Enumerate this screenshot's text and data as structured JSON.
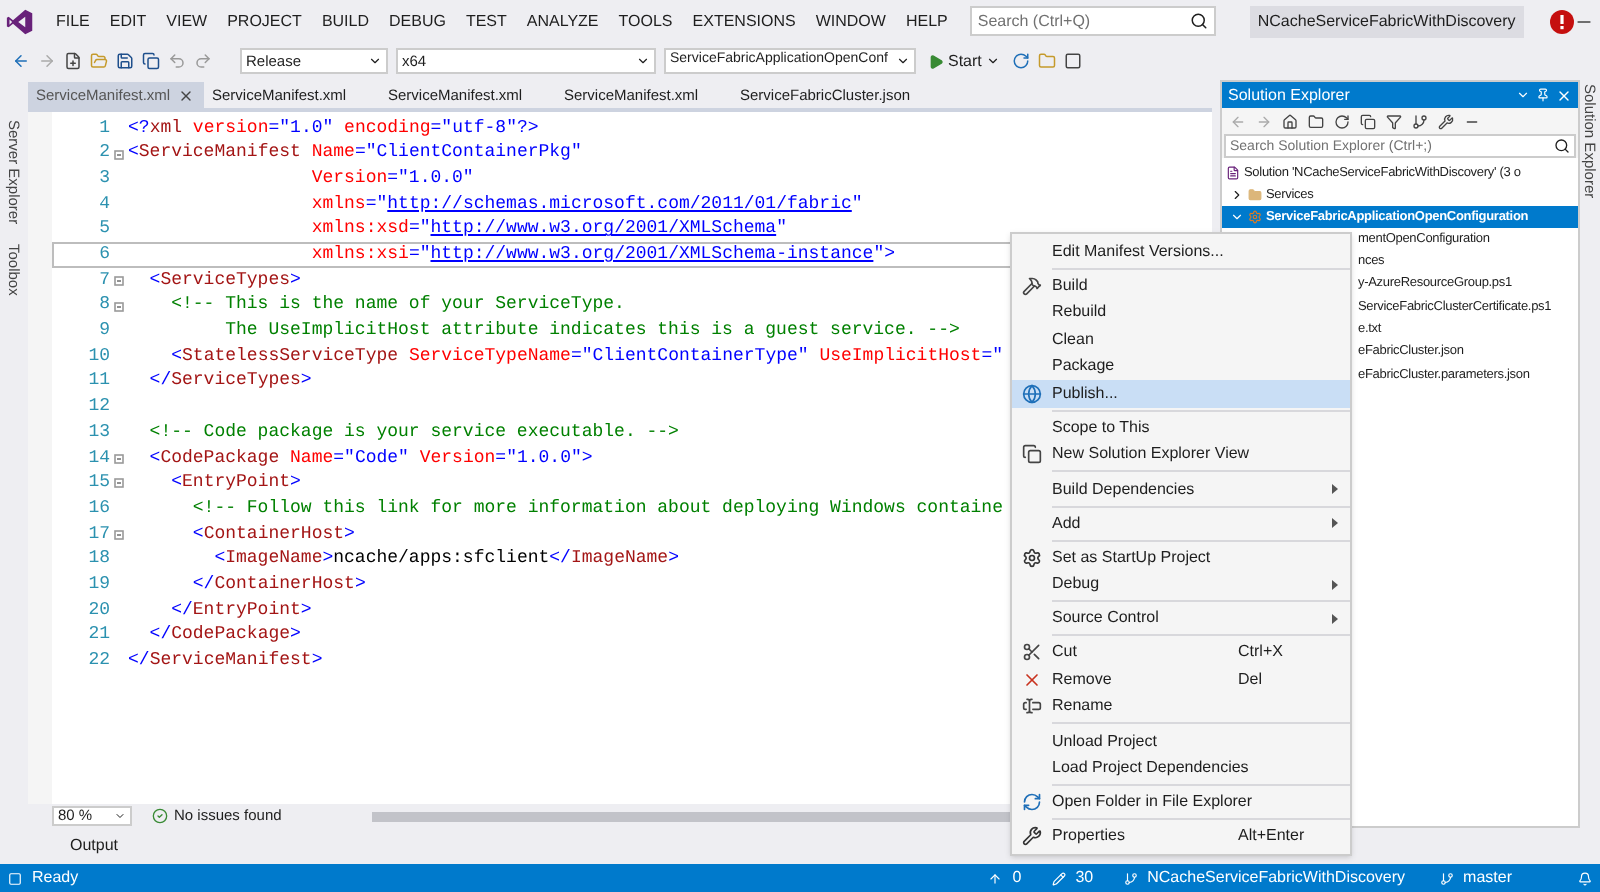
{
  "menu_bar": {
    "items": [
      "FILE",
      "EDIT",
      "VIEW",
      "PROJECT",
      "BUILD",
      "DEBUG",
      "TEST",
      "ANALYZE",
      "TOOLS",
      "EXTENSIONS",
      "WINDOW",
      "HELP"
    ],
    "search": {
      "placeholder": "Search (Ctrl+Q)"
    },
    "solution_name": "NCacheServiceFabricWithDiscovery"
  },
  "toolbar": {
    "configuration": "Release",
    "platform": "x64",
    "startup_project": "ServiceFabricApplicationOpenConf",
    "start": "Start"
  },
  "left_strip": [
    "Server Explorer",
    "Toolbox"
  ],
  "tabs": [
    {
      "label": "ServiceManifest.xml",
      "selected": true,
      "closable": true
    },
    {
      "label": "ServiceManifest.xml",
      "selected": false,
      "closable": false
    },
    {
      "label": "ServiceManifest.xml",
      "selected": false,
      "closable": false
    },
    {
      "label": "ServiceManifest.xml",
      "selected": false,
      "closable": false
    },
    {
      "label": "ServiceFabricCluster.json",
      "selected": false,
      "closable": false
    }
  ],
  "editor": {
    "lines": [
      {
        "number": "1",
        "fold": false,
        "current": false,
        "tokens": [
          {
            "kind": "punct",
            "text": "<?"
          },
          {
            "kind": "tag",
            "text": "xml"
          },
          {
            "kind": "attr",
            "text": " version"
          },
          {
            "kind": "punct",
            "text": "="
          },
          {
            "kind": "value",
            "text": "\"1.0\""
          },
          {
            "kind": "attr",
            "text": " encoding"
          },
          {
            "kind": "punct",
            "text": "="
          },
          {
            "kind": "value",
            "text": "\"utf-8\""
          },
          {
            "kind": "punct",
            "text": "?>"
          }
        ]
      },
      {
        "number": "2",
        "fold": true,
        "current": false,
        "tokens": [
          {
            "kind": "punct",
            "text": "<"
          },
          {
            "kind": "tag",
            "text": "ServiceManifest"
          },
          {
            "kind": "attr",
            "text": " Name"
          },
          {
            "kind": "punct",
            "text": "="
          },
          {
            "kind": "value",
            "text": "\"ClientContainerPkg\""
          }
        ]
      },
      {
        "number": "3",
        "fold": false,
        "current": false,
        "tokens": [
          {
            "kind": "attr",
            "text": "                 Version"
          },
          {
            "kind": "punct",
            "text": "="
          },
          {
            "kind": "value",
            "text": "\"1.0.0\""
          }
        ]
      },
      {
        "number": "4",
        "fold": false,
        "current": false,
        "tokens": [
          {
            "kind": "attr",
            "text": "                 xmlns"
          },
          {
            "kind": "punct",
            "text": "="
          },
          {
            "kind": "value",
            "text": "\""
          },
          {
            "kind": "link",
            "text": "http://schemas.microsoft.com/2011/01/fabric"
          },
          {
            "kind": "value",
            "text": "\""
          }
        ]
      },
      {
        "number": "5",
        "fold": false,
        "current": false,
        "tokens": [
          {
            "kind": "attr",
            "text": "                 xmlns:xsd"
          },
          {
            "kind": "punct",
            "text": "="
          },
          {
            "kind": "value",
            "text": "\""
          },
          {
            "kind": "link",
            "text": "http://www.w3.org/2001/XMLSchema"
          },
          {
            "kind": "value",
            "text": "\""
          }
        ]
      },
      {
        "number": "6",
        "fold": false,
        "current": true,
        "tokens": [
          {
            "kind": "attr",
            "text": "                 xmlns:xsi"
          },
          {
            "kind": "punct",
            "text": "="
          },
          {
            "kind": "value",
            "text": "\""
          },
          {
            "kind": "link",
            "text": "http://www.w3.org/2001/XMLSchema-instance"
          },
          {
            "kind": "value",
            "text": "\""
          },
          {
            "kind": "punct",
            "text": ">"
          }
        ]
      },
      {
        "number": "7",
        "fold": true,
        "current": false,
        "tokens": [
          {
            "kind": "punct",
            "text": "  <"
          },
          {
            "kind": "tag",
            "text": "ServiceTypes"
          },
          {
            "kind": "punct",
            "text": ">"
          }
        ]
      },
      {
        "number": "8",
        "fold": true,
        "current": false,
        "tokens": [
          {
            "kind": "comment",
            "text": "    <!-- This is the name of your ServiceType."
          }
        ]
      },
      {
        "number": "9",
        "fold": false,
        "current": false,
        "tokens": [
          {
            "kind": "comment",
            "text": "         The UseImplicitHost attribute indicates this is a guest service. -->"
          }
        ]
      },
      {
        "number": "10",
        "fold": false,
        "current": false,
        "tokens": [
          {
            "kind": "punct",
            "text": "    <"
          },
          {
            "kind": "tag",
            "text": "StatelessServiceType"
          },
          {
            "kind": "attr",
            "text": " ServiceTypeName"
          },
          {
            "kind": "punct",
            "text": "="
          },
          {
            "kind": "value",
            "text": "\"ClientContainerType\""
          },
          {
            "kind": "attr",
            "text": " UseImplicitHost"
          },
          {
            "kind": "punct",
            "text": "="
          },
          {
            "kind": "value",
            "text": "\""
          }
        ]
      },
      {
        "number": "11",
        "fold": false,
        "current": false,
        "tokens": [
          {
            "kind": "punct",
            "text": "  </"
          },
          {
            "kind": "tag",
            "text": "ServiceTypes"
          },
          {
            "kind": "punct",
            "text": ">"
          }
        ]
      },
      {
        "number": "12",
        "fold": false,
        "current": false
      },
      {
        "number": "13",
        "fold": false,
        "current": false,
        "tokens": [
          {
            "kind": "comment",
            "text": "  <!-- Code package is your service executable. -->"
          }
        ]
      },
      {
        "number": "14",
        "fold": true,
        "current": false,
        "tokens": [
          {
            "kind": "punct",
            "text": "  <"
          },
          {
            "kind": "tag",
            "text": "CodePackage"
          },
          {
            "kind": "attr",
            "text": " Name"
          },
          {
            "kind": "punct",
            "text": "="
          },
          {
            "kind": "value",
            "text": "\"Code\""
          },
          {
            "kind": "attr",
            "text": " Version"
          },
          {
            "kind": "punct",
            "text": "="
          },
          {
            "kind": "value",
            "text": "\"1.0.0\""
          },
          {
            "kind": "punct",
            "text": ">"
          }
        ]
      },
      {
        "number": "15",
        "fold": true,
        "current": false,
        "tokens": [
          {
            "kind": "punct",
            "text": "    <"
          },
          {
            "kind": "tag",
            "text": "EntryPoint"
          },
          {
            "kind": "punct",
            "text": ">"
          }
        ]
      },
      {
        "number": "16",
        "fold": false,
        "current": false,
        "tokens": [
          {
            "kind": "comment",
            "text": "      <!-- Follow this link for more information about deploying Windows containe"
          }
        ]
      },
      {
        "number": "17",
        "fold": true,
        "current": false,
        "tokens": [
          {
            "kind": "punct",
            "text": "      <"
          },
          {
            "kind": "tag",
            "text": "ContainerHost"
          },
          {
            "kind": "punct",
            "text": ">"
          }
        ]
      },
      {
        "number": "18",
        "fold": false,
        "current": false,
        "tokens": [
          {
            "kind": "punct",
            "text": "        <"
          },
          {
            "kind": "tag",
            "text": "ImageName"
          },
          {
            "kind": "punct",
            "text": ">"
          },
          {
            "kind": "text",
            "text": "ncache/apps:sfclient"
          },
          {
            "kind": "punct",
            "text": "</"
          },
          {
            "kind": "tag",
            "text": "ImageName"
          },
          {
            "kind": "punct",
            "text": ">"
          }
        ]
      },
      {
        "number": "19",
        "fold": false,
        "current": false,
        "tokens": [
          {
            "kind": "punct",
            "text": "      </"
          },
          {
            "kind": "tag",
            "text": "ContainerHost"
          },
          {
            "kind": "punct",
            "text": ">"
          }
        ]
      },
      {
        "number": "20",
        "fold": false,
        "current": false,
        "tokens": [
          {
            "kind": "punct",
            "text": "    </"
          },
          {
            "kind": "tag",
            "text": "EntryPoint"
          },
          {
            "kind": "punct",
            "text": ">"
          }
        ]
      },
      {
        "number": "21",
        "fold": false,
        "current": false,
        "tokens": [
          {
            "kind": "punct",
            "text": "  </"
          },
          {
            "kind": "tag",
            "text": "CodePackage"
          },
          {
            "kind": "punct",
            "text": ">"
          }
        ]
      },
      {
        "number": "22",
        "fold": false,
        "current": false,
        "tokens": [
          {
            "kind": "punct",
            "text": "</"
          },
          {
            "kind": "tag",
            "text": "ServiceManifest"
          },
          {
            "kind": "punct",
            "text": ">"
          }
        ]
      }
    ],
    "zoom": "80 %",
    "issues": "No issues found"
  },
  "solution_explorer": {
    "title": "Solution Explorer",
    "search": {
      "placeholder": "Search Solution Explorer (Ctrl+;)"
    },
    "tree": [
      {
        "label": "Solution 'NCacheServiceFabricWithDiscovery' (3 o",
        "selected": false,
        "children": [
          {
            "label": "Services",
            "kind": "folder",
            "selected": false,
            "expanded": false
          },
          {
            "label": "ServiceFabricApplicationOpenConfiguration",
            "kind": "project",
            "selected": true,
            "expanded": true,
            "children": [
              {
                "label": "mentOpenConfiguration",
                "selected": false
              },
              {
                "label": "nces",
                "selected": false
              },
              {
                "label": "y-AzureResourceGroup.ps1",
                "selected": false
              },
              {
                "label": "ServiceFabricClusterCertificate.ps1",
                "selected": false
              },
              {
                "label": "e.txt",
                "selected": false
              },
              {
                "label": "eFabricCluster.json",
                "selected": false
              },
              {
                "label": "eFabricCluster.parameters.json",
                "selected": false
              }
            ]
          }
        ]
      }
    ]
  },
  "right_strip": "Solution Explorer",
  "context_menu": {
    "items": [
      {
        "kind": "item",
        "label": "Edit Manifest Versions...",
        "selected": false
      },
      {
        "kind": "separator"
      },
      {
        "kind": "item",
        "label": "Build",
        "selected": false
      },
      {
        "kind": "item",
        "label": "Rebuild",
        "selected": false
      },
      {
        "kind": "item",
        "label": "Clean",
        "selected": false
      },
      {
        "kind": "item",
        "label": "Package",
        "selected": false
      },
      {
        "kind": "item",
        "label": "Publish...",
        "selected": true
      },
      {
        "kind": "separator"
      },
      {
        "kind": "item",
        "label": "Scope to This",
        "selected": false
      },
      {
        "kind": "item",
        "label": "New Solution Explorer View",
        "selected": false
      },
      {
        "kind": "separator"
      },
      {
        "kind": "item",
        "label": "Build Dependencies",
        "selected": false,
        "submenu": true
      },
      {
        "kind": "separator"
      },
      {
        "kind": "item",
        "label": "Add",
        "selected": false,
        "submenu": true
      },
      {
        "kind": "separator"
      },
      {
        "kind": "item",
        "label": "Set as StartUp Project",
        "selected": false
      },
      {
        "kind": "item",
        "label": "Debug",
        "selected": false,
        "submenu": true
      },
      {
        "kind": "separator"
      },
      {
        "kind": "item",
        "label": "Source Control",
        "selected": false,
        "submenu": true
      },
      {
        "kind": "separator"
      },
      {
        "kind": "item",
        "label": "Cut",
        "shortcut": "Ctrl+X",
        "selected": false
      },
      {
        "kind": "item",
        "label": "Remove",
        "shortcut": "Del",
        "selected": false
      },
      {
        "kind": "item",
        "label": "Rename",
        "selected": false
      },
      {
        "kind": "separator"
      },
      {
        "kind": "item",
        "label": "Unload Project",
        "selected": false
      },
      {
        "kind": "item",
        "label": "Load Project Dependencies",
        "selected": false
      },
      {
        "kind": "separator"
      },
      {
        "kind": "item",
        "label": "Open Folder in File Explorer",
        "selected": false
      },
      {
        "kind": "separator"
      },
      {
        "kind": "item",
        "label": "Properties",
        "shortcut": "Alt+Enter",
        "selected": false
      }
    ]
  },
  "output_tab": "Output",
  "status_bar": {
    "status": "Ready",
    "up": "0",
    "edits": "30",
    "repository": "NCacheServiceFabricWithDiscovery",
    "branch": "master"
  }
}
